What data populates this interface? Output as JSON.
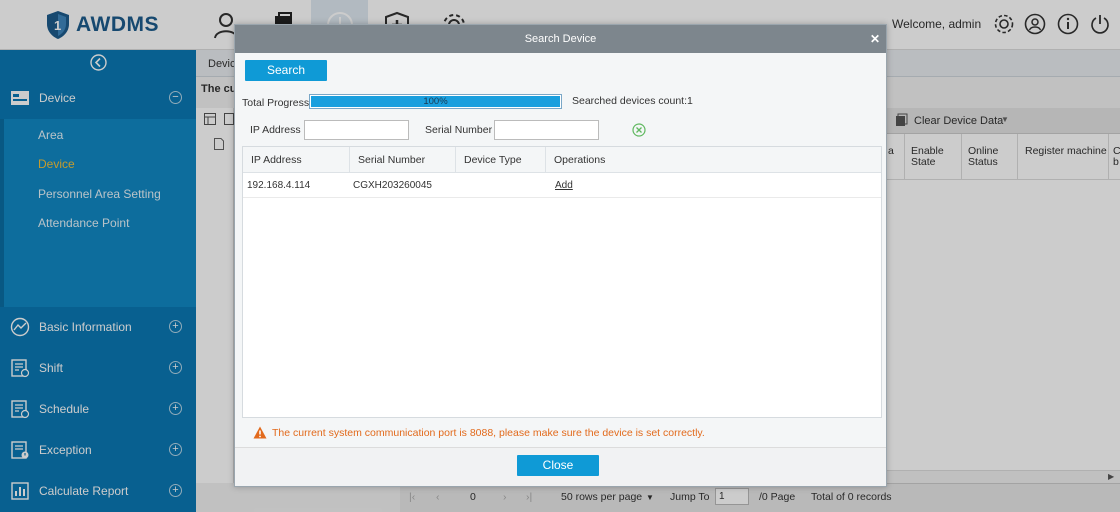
{
  "app": {
    "name": "AWDMS",
    "welcome": "Welcome, admin"
  },
  "top_nav": {
    "icons": [
      "personnel-icon",
      "device-icon",
      "attendance-icon",
      "medical-icon",
      "system-settings-icon"
    ],
    "active_index": 2
  },
  "sidebar": {
    "device_label": "Device",
    "sub_items": [
      "Area",
      "Device",
      "Personnel Area Setting",
      "Attendance Point"
    ],
    "active_sub": "Device",
    "sections": [
      "Basic Information",
      "Shift",
      "Schedule",
      "Exception",
      "Calculate Report"
    ]
  },
  "background": {
    "tab_fragment": "Devic",
    "breadcrumb_fragment": "The cu",
    "toolbar_clear": "Clear Device Data",
    "col_a": "a",
    "col_enable": "Enable\nState",
    "col_online": "Online\nStatus",
    "col_register": "Register machine",
    "col_cut": "C\nb",
    "pager": {
      "page": "0",
      "rows_per_page": "50 rows per page",
      "jump_to": "Jump To",
      "jump_value": "1",
      "of_page": "/0 Page",
      "total": "Total of 0 records"
    }
  },
  "dialog": {
    "title": "Search Device",
    "search_button": "Search",
    "total_progress_label": "Total Progress",
    "progress_percent": 100,
    "progress_text": "100%",
    "searched_count_label": "Searched devices count:1",
    "ip_label": "IP Address",
    "ip_value": "",
    "sn_label": "Serial Number",
    "sn_value": "",
    "table": {
      "headers": [
        "IP Address",
        "Serial Number",
        "Device Type",
        "Operations"
      ],
      "rows": [
        {
          "ip": "192.168.4.114",
          "serial": "CGXH203260045",
          "type": "",
          "operation": "Add"
        }
      ]
    },
    "warning": "The current system communication port is 8088, please make sure the device is set correctly.",
    "close_button": "Close"
  },
  "colors": {
    "sidebar": "#0a78b4",
    "accent": "#0f9ad6",
    "active_sub": "#f5c23a",
    "warning": "#e26a1c"
  }
}
